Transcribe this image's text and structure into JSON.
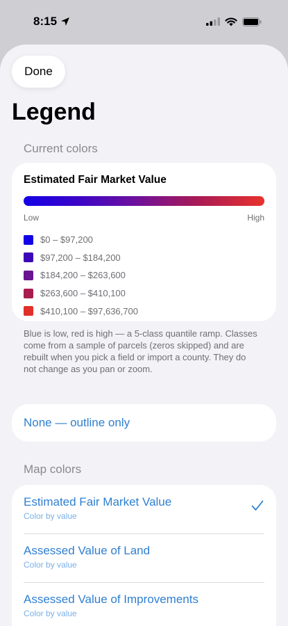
{
  "status_bar": {
    "time": "8:15"
  },
  "toolbar": {
    "done_label": "Done"
  },
  "page": {
    "title": "Legend"
  },
  "current_colors": {
    "header": "Current colors",
    "legend_title": "Estimated Fair Market Value",
    "low_label": "Low",
    "high_label": "High",
    "classes": [
      {
        "label": "$0 – $97,200",
        "color": "#1400e6"
      },
      {
        "label": "$97,200 – $184,200",
        "color": "#3d06b8"
      },
      {
        "label": "$184,200 – $263,600",
        "color": "#6a1491"
      },
      {
        "label": "$263,600 – $410,100",
        "color": "#a81c4e"
      },
      {
        "label": "$410,100 – $97,636,700",
        "color": "#e0302a"
      }
    ],
    "footnote": "Blue is low, red is high — a 5-class quantile ramp. Classes come from a sample of parcels (zeros skipped) and are rebuilt when you pick a field or import a county. They do not change as you pan or zoom."
  },
  "none_option": {
    "label": "None — outline only"
  },
  "map_colors": {
    "header": "Map colors",
    "items": [
      {
        "title": "Estimated Fair Market Value",
        "subtitle": "Color by value",
        "selected": true
      },
      {
        "title": "Assessed Value of Land",
        "subtitle": "Color by value",
        "selected": false
      },
      {
        "title": "Assessed Value of Improvements",
        "subtitle": "Color by value",
        "selected": false
      }
    ]
  },
  "colors": {
    "accent": "#2f7fd1",
    "background": "#f2f2f7"
  }
}
